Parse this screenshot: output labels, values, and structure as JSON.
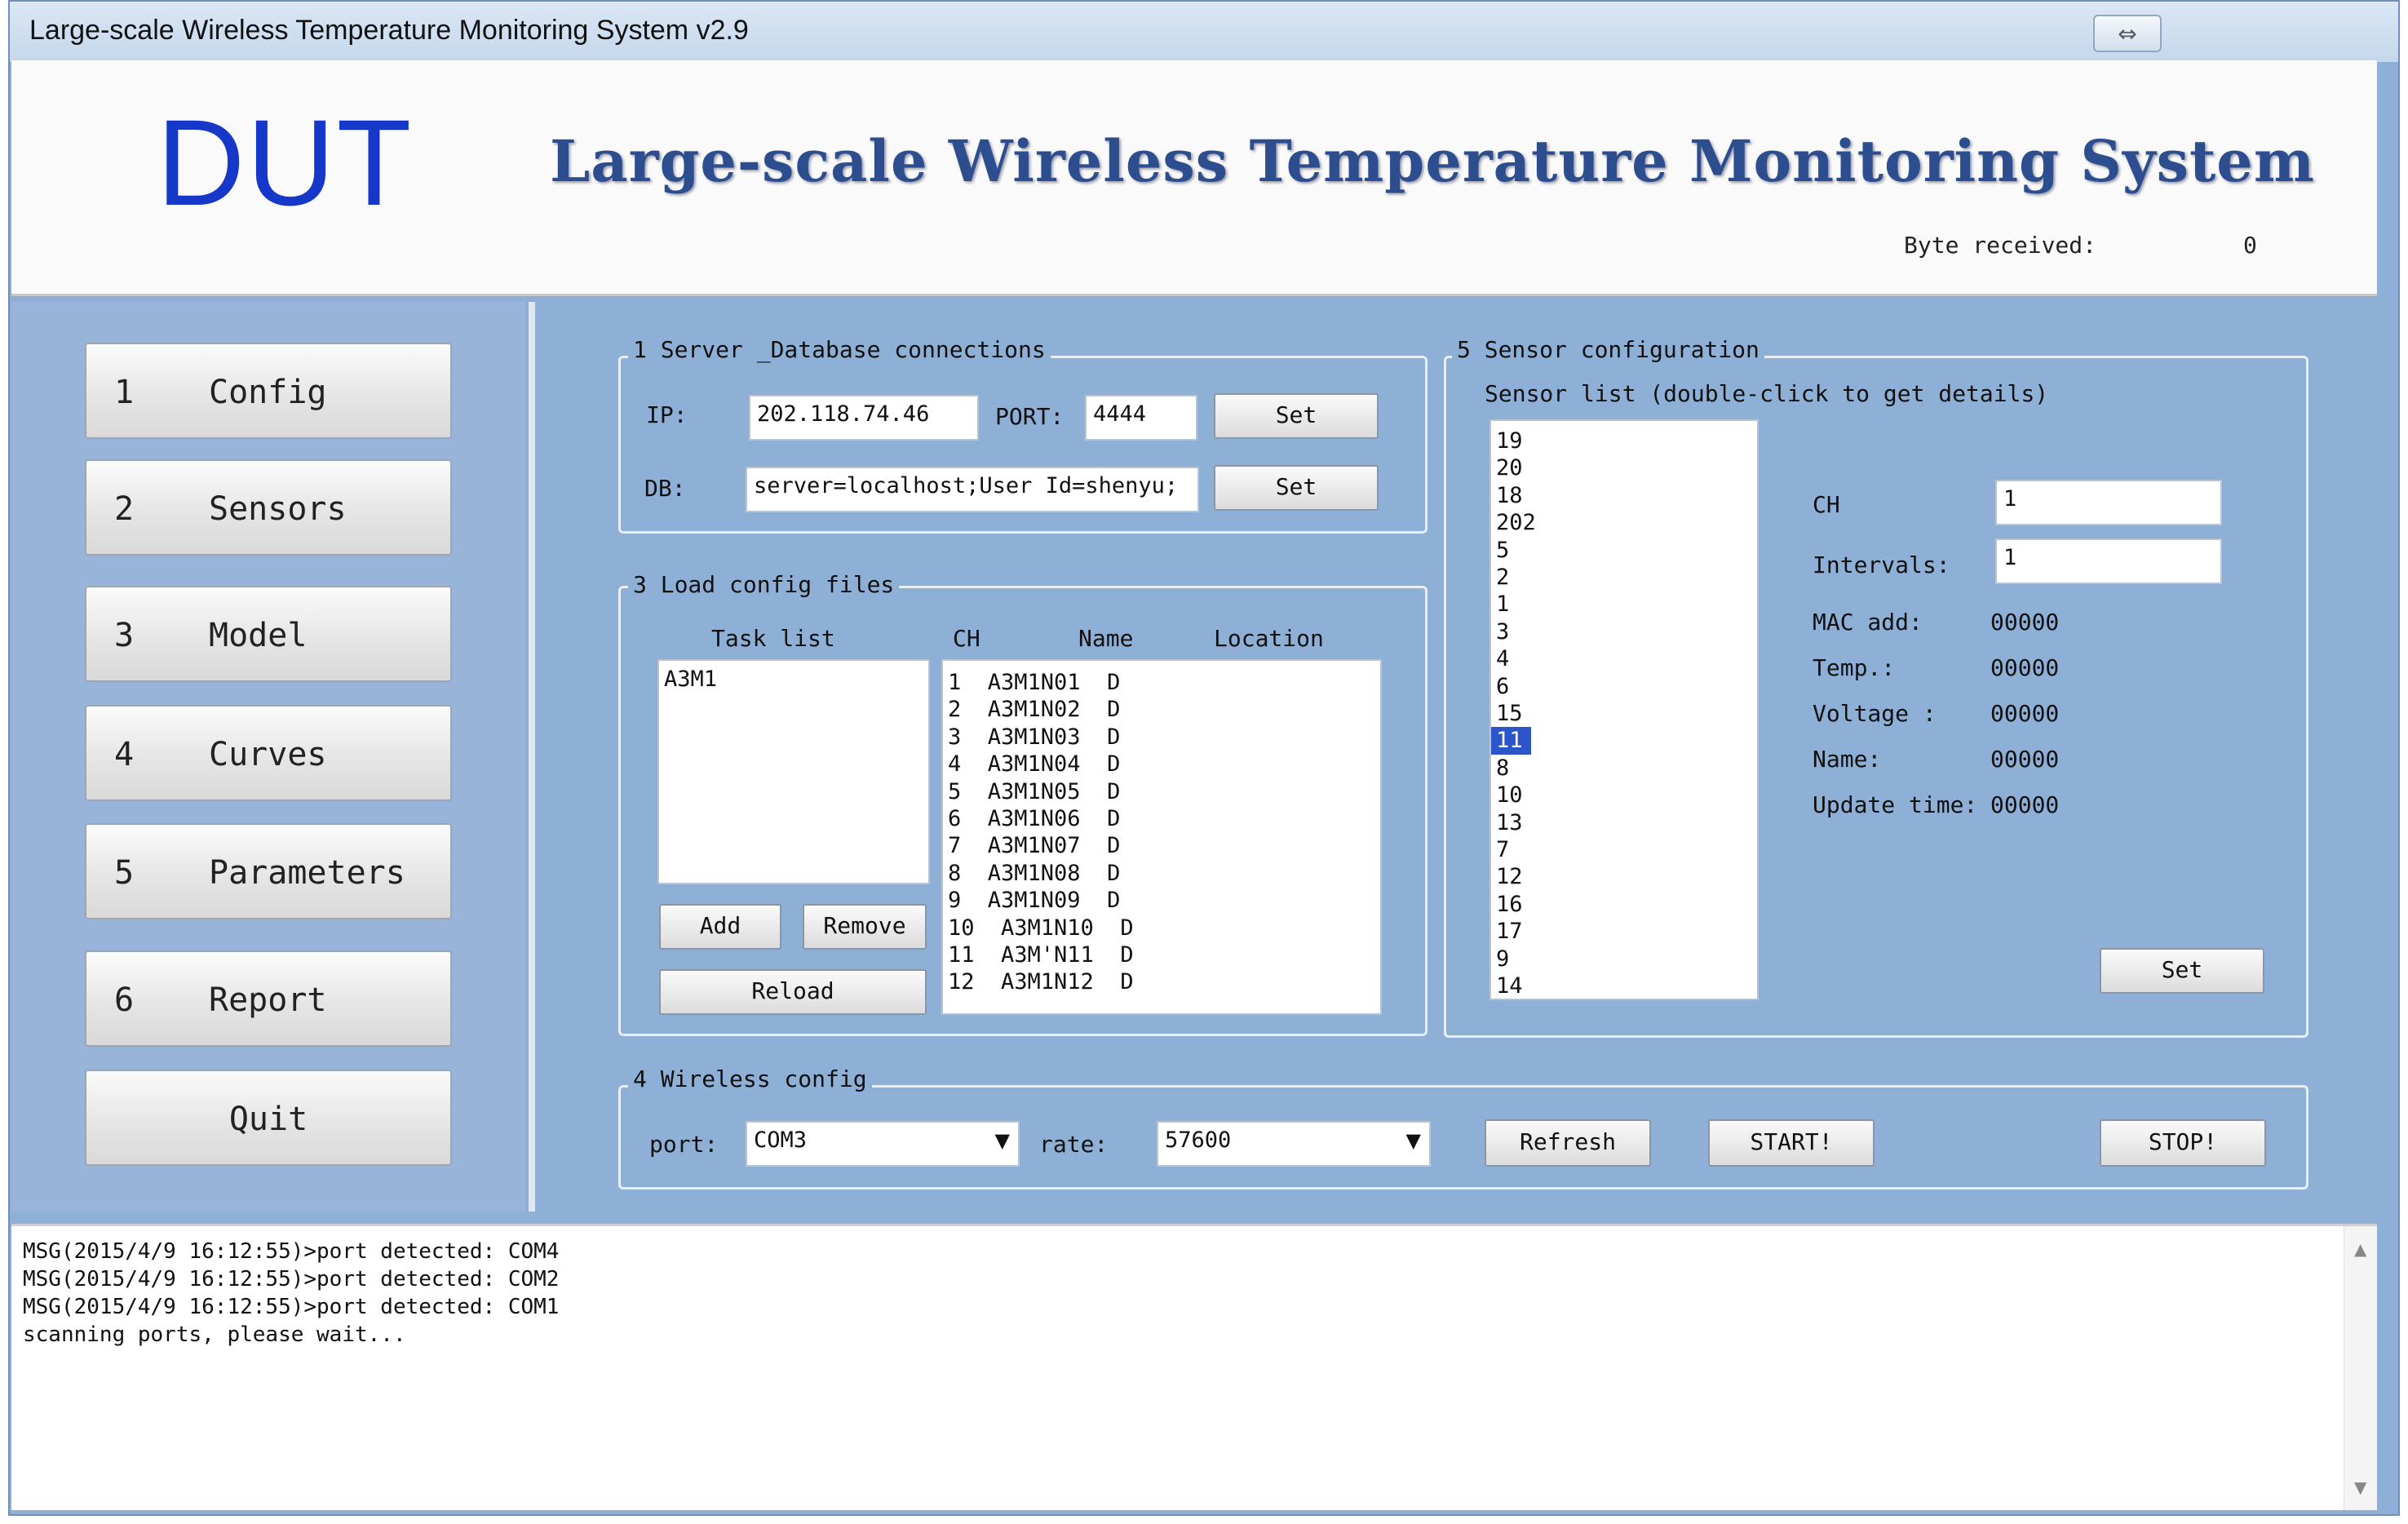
{
  "window": {
    "title": "Large-scale Wireless Temperature Monitoring System v2.9",
    "restore_glyph": "⇔"
  },
  "header": {
    "logo": "DUT",
    "title": "Large-scale Wireless Temperature Monitoring System",
    "byte_label": "Byte received:",
    "byte_value": "0"
  },
  "nav": [
    {
      "num": "1",
      "label": "Config"
    },
    {
      "num": "2",
      "label": "Sensors"
    },
    {
      "num": "3",
      "label": "Model"
    },
    {
      "num": "4",
      "label": "Curves"
    },
    {
      "num": "5",
      "label": "Parameters"
    },
    {
      "num": "6",
      "label": "Report"
    },
    {
      "num": "",
      "label": "Quit"
    }
  ],
  "server": {
    "title": "1 Server _Database connections",
    "ip_label": "IP:",
    "ip_value": "202.118.74.46",
    "port_label": "PORT:",
    "port_value": "4444",
    "set1": "Set",
    "db_label": "DB:",
    "db_value": "server=localhost;User Id=shenyu;",
    "set2": "Set"
  },
  "load": {
    "title": "3 Load config files",
    "task_header": "Task list",
    "tasks": [
      "A3M1"
    ],
    "col_ch": "CH",
    "col_name": "Name",
    "col_location": "Location",
    "channels": [
      "1  A3M1N01  D",
      "2  A3M1N02  D",
      "3  A3M1N03  D",
      "4  A3M1N04  D",
      "5  A3M1N05  D",
      "6  A3M1N06  D",
      "7  A3M1N07  D",
      "8  A3M1N08  D",
      "9  A3M1N09  D",
      "10  A3M1N10  D",
      "11  A3M'N11  D",
      "12  A3M1N12  D"
    ],
    "add": "Add",
    "remove": "Remove",
    "reload": "Reload"
  },
  "sensor": {
    "title": "5 Sensor configuration",
    "list_header": "Sensor list (double-click to get details)",
    "items": [
      "19",
      "20",
      "18",
      "202",
      "5",
      "2",
      "1",
      "3",
      "4",
      "6",
      "15",
      "11",
      "8",
      "10",
      "13",
      "7",
      "12",
      "16",
      "17",
      "9",
      "14"
    ],
    "selected": "11",
    "ch_label": "CH",
    "ch_value": "1",
    "intervals_label": "Intervals:",
    "intervals_value": "1",
    "mac_label": "MAC add:",
    "mac_value": "00000",
    "temp_label": "Temp.:",
    "temp_value": "00000",
    "voltage_label": "Voltage :",
    "voltage_value": "00000",
    "name_label": "Name:",
    "name_value": "00000",
    "update_label": "Update time:",
    "update_value": "00000",
    "set": "Set"
  },
  "wireless": {
    "title": "4 Wireless config",
    "port_label": "port:",
    "port_value": "COM3",
    "rate_label": "rate:",
    "rate_value": "57600",
    "refresh": "Refresh",
    "start": "START!",
    "stop": "STOP!"
  },
  "console": {
    "lines": [
      "MSG(2015/4/9 16:12:55)>port detected: COM4",
      "MSG(2015/4/9 16:12:55)>port detected: COM2",
      "MSG(2015/4/9 16:12:55)>port detected: COM1",
      "scanning ports, please wait..."
    ]
  }
}
